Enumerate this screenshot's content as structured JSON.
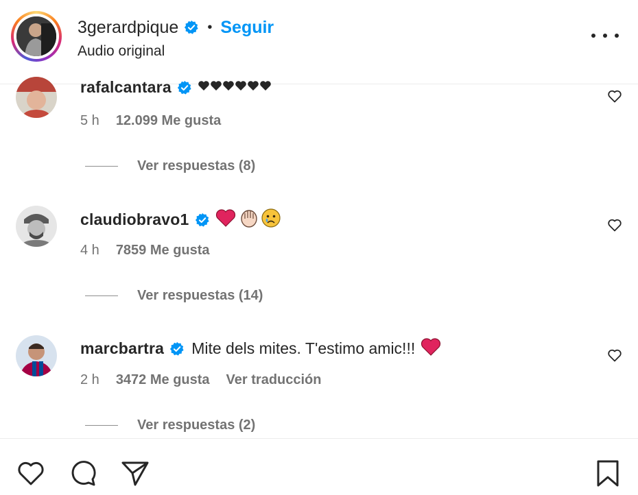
{
  "post": {
    "username": "3gerardpique",
    "follow_label": "Seguir",
    "separator": "•",
    "subtitle": "Audio original"
  },
  "comments": [
    {
      "username": "rafalcantara",
      "text": "",
      "emojis": [
        "black-heart",
        "black-heart",
        "black-heart",
        "black-heart",
        "black-heart",
        "black-heart"
      ],
      "time": "5 h",
      "likes": "12.099 Me gusta",
      "replies": "Ver respuestas (8)"
    },
    {
      "username": "claudiobravo1",
      "text": "",
      "emojis": [
        "red-heart",
        "clapping-hands",
        "crying-face"
      ],
      "time": "4 h",
      "likes": "7859 Me gusta",
      "replies": "Ver respuestas (14)"
    },
    {
      "username": "marcbartra",
      "text": "Mite dels mites. T'estimo amic!!!",
      "emojis": [
        "red-heart"
      ],
      "time": "2 h",
      "likes": "3472 Me gusta",
      "translate": "Ver traducción",
      "replies": "Ver respuestas (2)"
    }
  ],
  "icons": {
    "verified": "verified-badge-icon",
    "more": "more-options-icon",
    "comment_like": "heart-outline-icon",
    "like": "heart-icon",
    "comment": "comment-icon",
    "share": "paper-plane-icon",
    "save": "bookmark-icon"
  },
  "colors": {
    "link": "#0095f6",
    "verified": "#0095f6",
    "muted": "#737373",
    "text": "#262626",
    "red_heart": "#e0245e"
  }
}
